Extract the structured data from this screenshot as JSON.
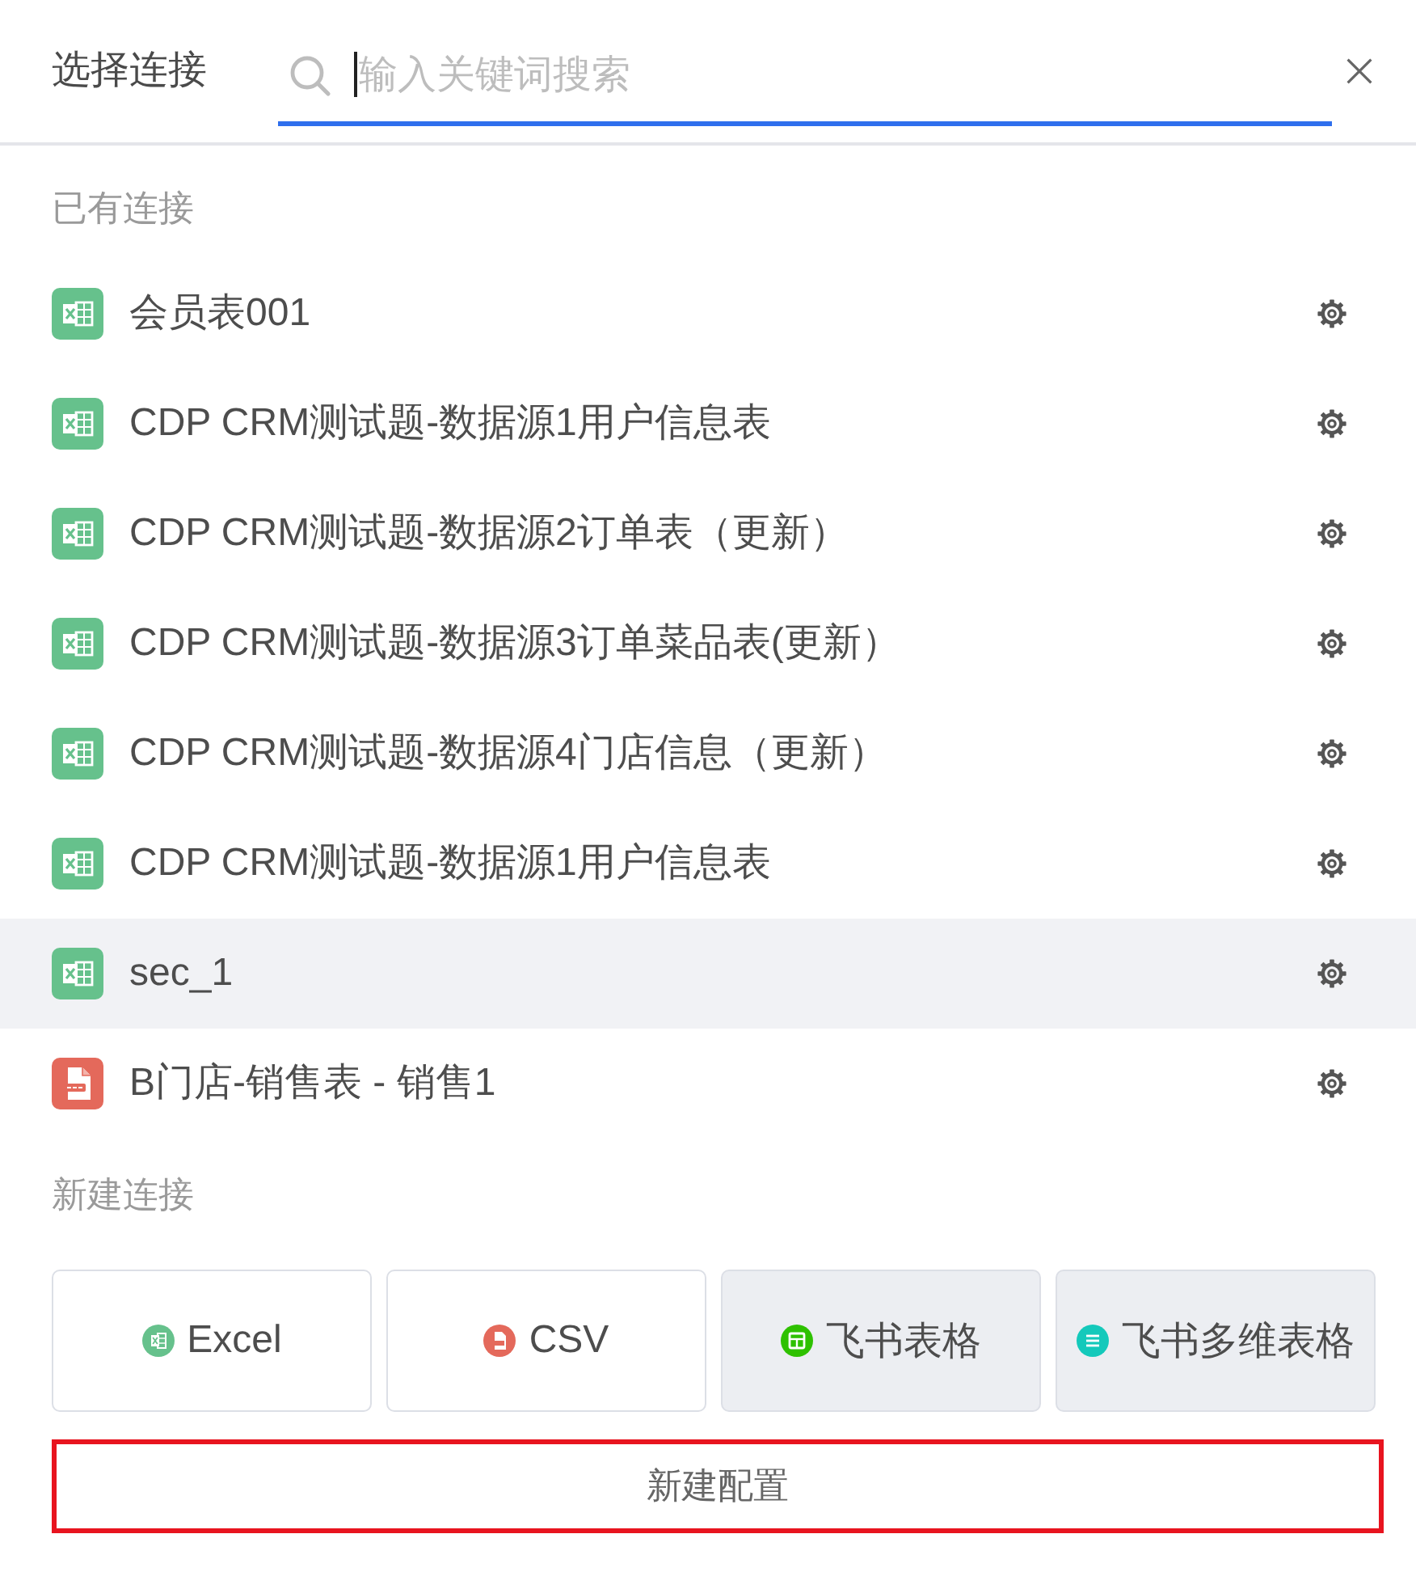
{
  "header": {
    "title": "选择连接",
    "search": {
      "placeholder": "输入关键词搜索",
      "focused": true
    }
  },
  "existing": {
    "label": "已有连接",
    "items": [
      {
        "name": "会员表001",
        "kind": "excel",
        "highlighted": false
      },
      {
        "name": "CDP CRM测试题-数据源1用户信息表",
        "kind": "excel",
        "highlighted": false
      },
      {
        "name": "CDP CRM测试题-数据源2订单表（更新）",
        "kind": "excel",
        "highlighted": false
      },
      {
        "name": "CDP CRM测试题-数据源3订单菜品表(更新）",
        "kind": "excel",
        "highlighted": false
      },
      {
        "name": "CDP CRM测试题-数据源4门店信息（更新）",
        "kind": "excel",
        "highlighted": false
      },
      {
        "name": "CDP CRM测试题-数据源1用户信息表",
        "kind": "excel",
        "highlighted": false
      },
      {
        "name": "sec_1",
        "kind": "excel",
        "highlighted": true
      },
      {
        "name": "B门店-销售表 - 销售1",
        "kind": "csv",
        "highlighted": false
      }
    ]
  },
  "create": {
    "label": "新建连接",
    "options": [
      {
        "label": "Excel",
        "kind": "excel",
        "filled": false
      },
      {
        "label": "CSV",
        "kind": "csv",
        "filled": false
      },
      {
        "label": "飞书表格",
        "kind": "feishu-sheet",
        "filled": true
      },
      {
        "label": "飞书多维表格",
        "kind": "feishu-base",
        "filled": true
      }
    ],
    "new_config": {
      "label": "新建配置",
      "highlighted": true
    }
  }
}
